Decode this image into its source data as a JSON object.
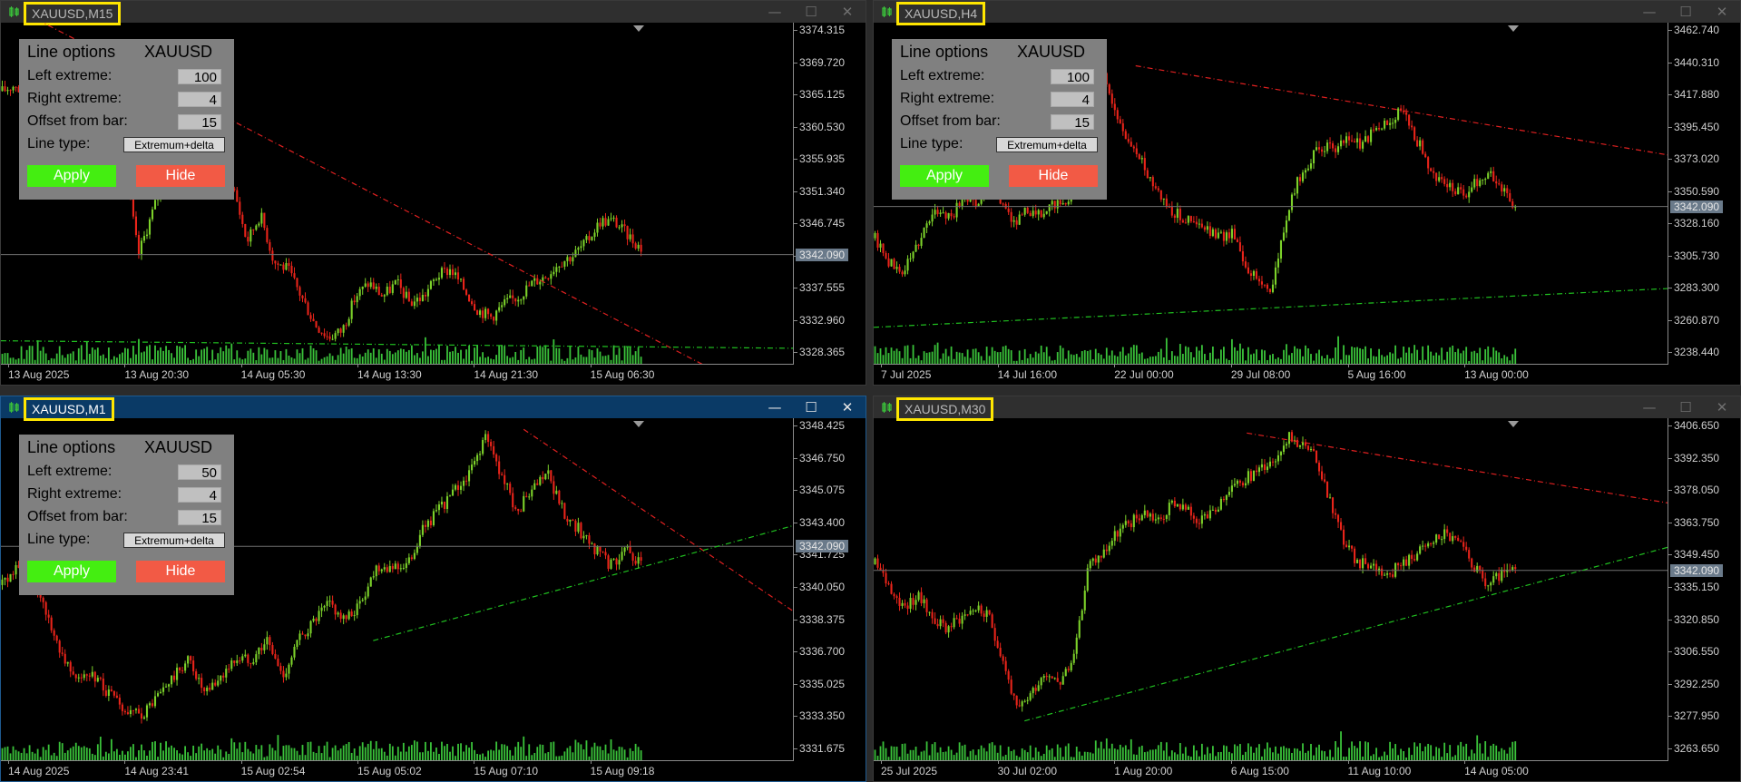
{
  "colors": {
    "up": "#7cd12a",
    "down": "#e8241a",
    "volume": "#3ac23a",
    "resistance": "#e02020",
    "support": "#20c020",
    "grid": "#707070"
  },
  "charts": [
    {
      "title": "XAUUSD,M15",
      "active": false,
      "price_labels": [
        "3374.315",
        "3369.720",
        "3365.125",
        "3360.530",
        "3355.935",
        "3351.340",
        "3346.745",
        "3342.090",
        "3337.555",
        "3332.960",
        "3328.365"
      ],
      "current_price": "3342.090",
      "time_labels": [
        "13 Aug 2025",
        "13 Aug 20:30",
        "14 Aug 05:30",
        "14 Aug 13:30",
        "14 Aug 21:30",
        "15 Aug 06:30"
      ],
      "panel": {
        "title": "Line options",
        "symbol": "XAUUSD",
        "left_label": "Left extreme:",
        "left_value": "100",
        "right_label": "Right extreme:",
        "right_value": "4",
        "offset_label": "Offset from bar:",
        "offset_value": "15",
        "type_label": "Line type:",
        "type_value": "Extremum+delta",
        "apply": "Apply",
        "hide": "Hide"
      },
      "chart_data": {
        "type": "candlestick",
        "ylim": [
          3326.0,
          3376.0
        ],
        "close_path": [
          3366,
          3367,
          3363,
          3358,
          3360,
          3358,
          3362,
          3360,
          3366,
          3356,
          3342,
          3348,
          3354,
          3357,
          3356,
          3355,
          3356,
          3352,
          3344,
          3348,
          3341,
          3340,
          3336,
          3332,
          3330,
          3331,
          3336,
          3338,
          3336,
          3338,
          3335,
          3336,
          3339,
          3340,
          3337,
          3334,
          3333,
          3335,
          3336,
          3338,
          3339,
          3341,
          3342,
          3344,
          3347,
          3347,
          3345,
          3343
        ],
        "resistance": {
          "from": [
            0.02,
            3378.0
          ],
          "to": [
            0.97,
            3321.0
          ]
        },
        "support": {
          "from": [
            0.0,
            3329.5
          ],
          "to": [
            1.0,
            3328.4
          ]
        }
      }
    },
    {
      "title": "XAUUSD,H4",
      "active": false,
      "price_labels": [
        "3462.740",
        "3440.310",
        "3417.880",
        "3395.450",
        "3373.020",
        "3350.590",
        "3328.160",
        "3305.730",
        "3283.300",
        "3260.870",
        "3238.440"
      ],
      "current_price": "3342.090",
      "time_labels": [
        "7 Jul 2025",
        "14 Jul 16:00",
        "22 Jul 00:00",
        "29 Jul 08:00",
        "5 Aug 16:00",
        "13 Aug 00:00"
      ],
      "panel": {
        "title": "Line options",
        "symbol": "XAUUSD",
        "left_label": "Left extreme:",
        "left_value": "100",
        "right_label": "Right extreme:",
        "right_value": "4",
        "offset_label": "Offset from bar:",
        "offset_value": "15",
        "type_label": "Line type:",
        "type_value": "Extremum+delta",
        "apply": "Apply",
        "hide": "Hide"
      },
      "chart_data": {
        "type": "candlestick",
        "ylim": [
          3232.0,
          3470.0
        ],
        "close_path": [
          3320,
          3305,
          3295,
          3310,
          3330,
          3340,
          3335,
          3350,
          3345,
          3360,
          3345,
          3330,
          3340,
          3335,
          3345,
          3340,
          3420,
          3438,
          3430,
          3400,
          3385,
          3370,
          3355,
          3340,
          3335,
          3330,
          3325,
          3320,
          3325,
          3300,
          3290,
          3285,
          3330,
          3360,
          3375,
          3385,
          3380,
          3390,
          3385,
          3395,
          3400,
          3410,
          3395,
          3375,
          3360,
          3355,
          3350,
          3360,
          3365,
          3355,
          3342
        ],
        "resistance": {
          "from": [
            0.33,
            3440.0
          ],
          "to": [
            1.0,
            3378.0
          ]
        },
        "support": {
          "from": [
            0.0,
            3258.0
          ],
          "to": [
            1.0,
            3285.0
          ]
        }
      }
    },
    {
      "title": "XAUUSD,M1",
      "active": true,
      "price_labels": [
        "3348.425",
        "3346.750",
        "3345.075",
        "3343.400",
        "3341.725",
        "3340.050",
        "3338.375",
        "3336.700",
        "3335.025",
        "3333.350",
        "3331.675"
      ],
      "current_price": "3342.090",
      "time_labels": [
        "14 Aug 2025",
        "14 Aug 23:41",
        "15 Aug 02:54",
        "15 Aug 05:02",
        "15 Aug 07:10",
        "15 Aug 09:18"
      ],
      "panel": {
        "title": "Line options",
        "symbol": "XAUUSD",
        "left_label": "Left extreme:",
        "left_value": "50",
        "right_label": "Right extreme:",
        "right_value": "4",
        "offset_label": "Offset from bar:",
        "offset_value": "15",
        "type_label": "Line type:",
        "type_value": "Extremum+delta",
        "apply": "Apply",
        "hide": "Hide"
      },
      "chart_data": {
        "type": "candlestick",
        "ylim": [
          3330.5,
          3349.0
        ],
        "close_path": [
          3340,
          3341,
          3340,
          3338,
          3336,
          3335,
          3335,
          3334,
          3333,
          3333,
          3334,
          3335,
          3336,
          3334,
          3335,
          3336,
          3336,
          3337,
          3335,
          3337,
          3338,
          3339,
          3338,
          3339,
          3341,
          3341,
          3341,
          3343,
          3344,
          3345,
          3346,
          3348,
          3346,
          3344,
          3345,
          3346,
          3344,
          3343,
          3342,
          3341,
          3342,
          3341
        ],
        "resistance": {
          "from": [
            0.66,
            3348.4
          ],
          "to": [
            1.0,
            3338.6
          ]
        },
        "support": {
          "from": [
            0.47,
            3337.0
          ],
          "to": [
            1.0,
            3343.2
          ]
        }
      }
    },
    {
      "title": "XAUUSD,M30",
      "active": false,
      "price_labels": [
        "3406.650",
        "3392.350",
        "3378.050",
        "3363.750",
        "3349.450",
        "3335.150",
        "3320.850",
        "3306.550",
        "3292.250",
        "3277.950",
        "3263.650"
      ],
      "current_price": "3342.090",
      "time_labels": [
        "25 Jul 2025",
        "30 Jul 02:00",
        "1 Aug 20:00",
        "6 Aug 15:00",
        "11 Aug 10:00",
        "14 Aug 05:00"
      ],
      "panel": null,
      "chart_data": {
        "type": "candlestick",
        "ylim": [
          3252.0,
          3414.0
        ],
        "close_path": [
          3345,
          3335,
          3325,
          3330,
          3320,
          3315,
          3320,
          3325,
          3320,
          3300,
          3275,
          3285,
          3295,
          3290,
          3300,
          3345,
          3350,
          3360,
          3365,
          3370,
          3365,
          3375,
          3370,
          3365,
          3370,
          3380,
          3385,
          3390,
          3395,
          3405,
          3402,
          3395,
          3375,
          3355,
          3345,
          3345,
          3340,
          3345,
          3350,
          3355,
          3360,
          3355,
          3345,
          3335,
          3340,
          3342
        ],
        "resistance": {
          "from": [
            0.47,
            3407.0
          ],
          "to": [
            1.0,
            3374.0
          ]
        },
        "support": {
          "from": [
            0.19,
            3271.0
          ],
          "to": [
            1.0,
            3353.0
          ]
        }
      }
    }
  ]
}
